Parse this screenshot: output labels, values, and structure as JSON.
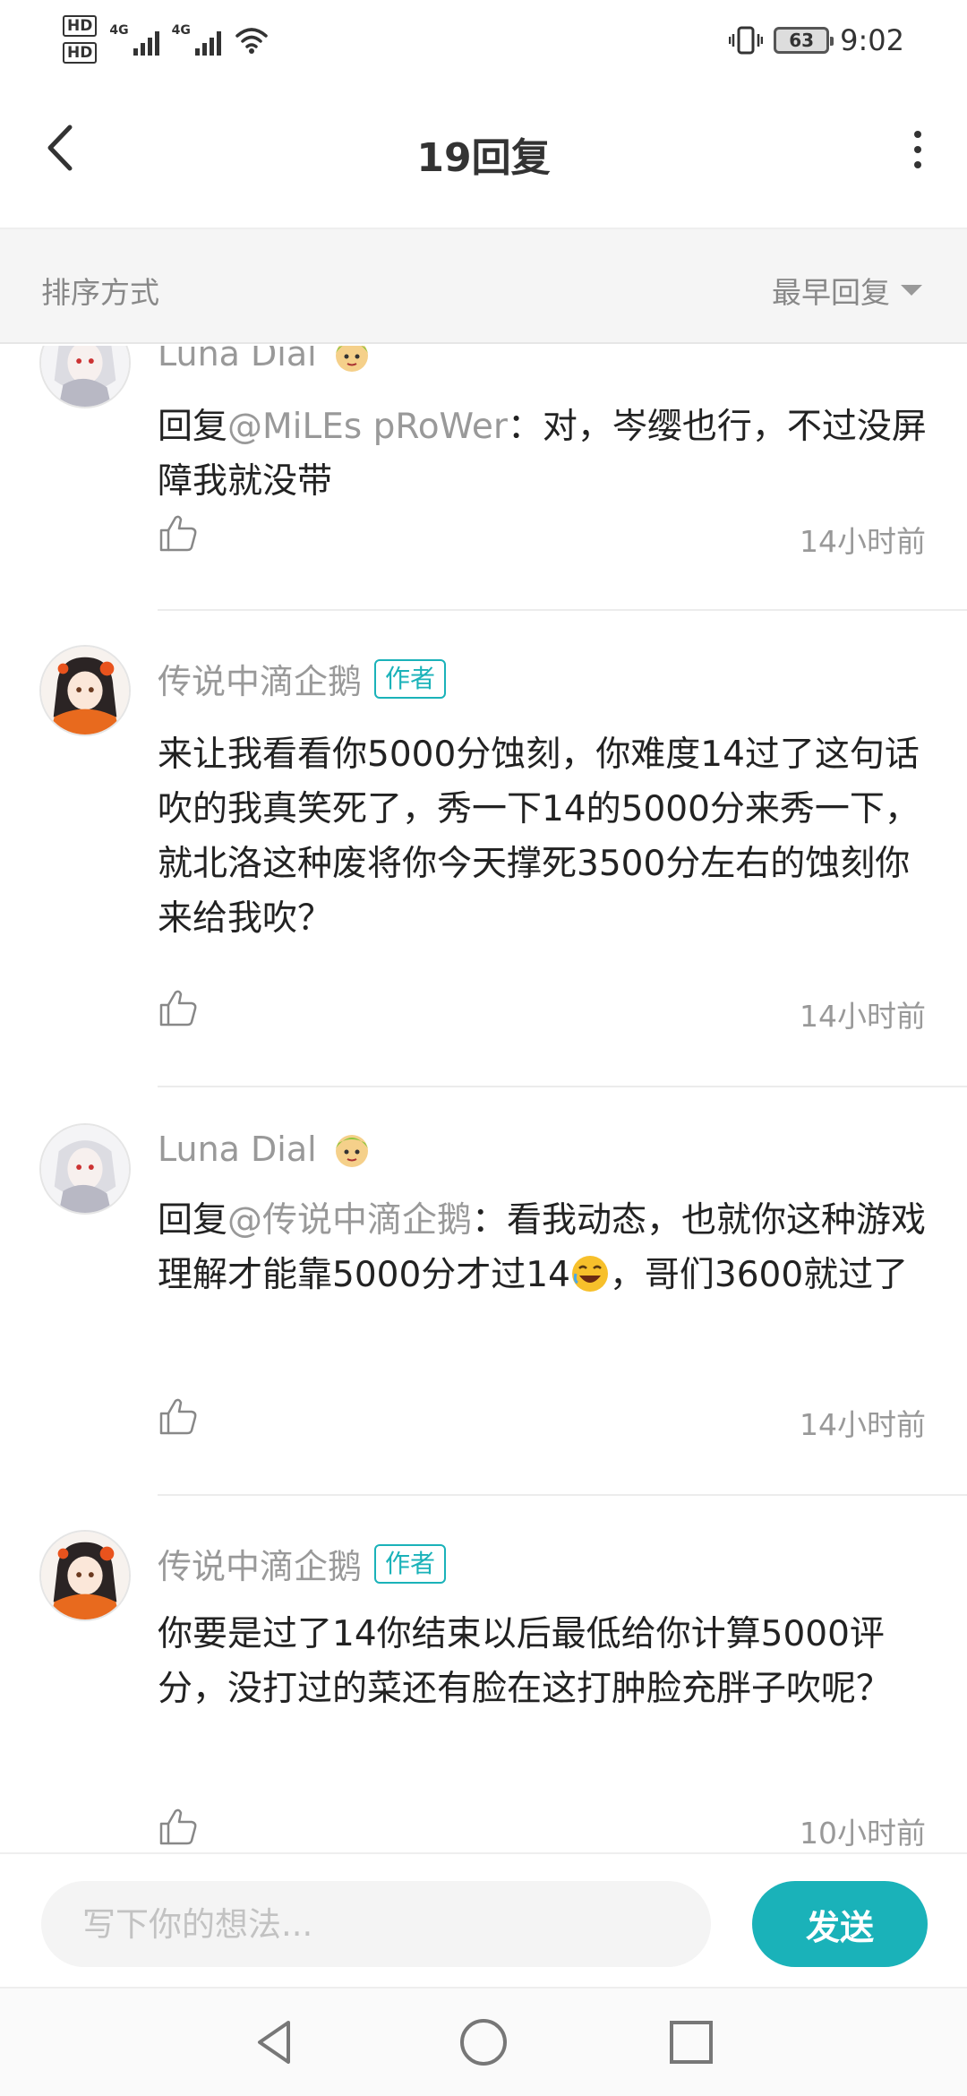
{
  "status_bar": {
    "hd1": "HD",
    "hd2": "HD",
    "net1": "4G",
    "net2": "4G",
    "battery": "63",
    "time": "9:02"
  },
  "header": {
    "title": "19回复"
  },
  "sort": {
    "label": "排序方式",
    "selected": "最早回复"
  },
  "comments": [
    {
      "author": "Luna Dial",
      "is_author": false,
      "mention": "@MiLEs pRoWer",
      "reply_prefix": "回复",
      "text": "：对，岑缨也行，不过没屏障我就没带",
      "time": "14小时前"
    },
    {
      "author": "传说中滴企鹅",
      "is_author": true,
      "badge": "作者",
      "text": "来让我看看你5000分蚀刻，你难度14过了这句话吹的我真笑死了，秀一下14的5000分来秀一下，就北洛这种废将你今天撑死3500分左右的蚀刻你来给我吹？",
      "time": "14小时前"
    },
    {
      "author": "Luna Dial",
      "is_author": false,
      "reply_prefix": "回复",
      "mention": "@传说中滴企鹅",
      "text_before_emoji": "：看我动态，也就你这种游戏理解才能靠5000分才过14",
      "text_after_emoji": "，哥们3600就过了",
      "time": "14小时前"
    },
    {
      "author": "传说中滴企鹅",
      "is_author": true,
      "badge": "作者",
      "text": "你要是过了14你结束以后最低给你计算5000评分，没打过的菜还有脸在这打肿脸充胖子吹呢？",
      "time": "10小时前"
    }
  ],
  "input": {
    "placeholder": "写下你的想法...",
    "send_label": "发送"
  },
  "colors": {
    "accent": "#1ab2b9",
    "muted_text": "#999999",
    "body_text": "#222222"
  }
}
